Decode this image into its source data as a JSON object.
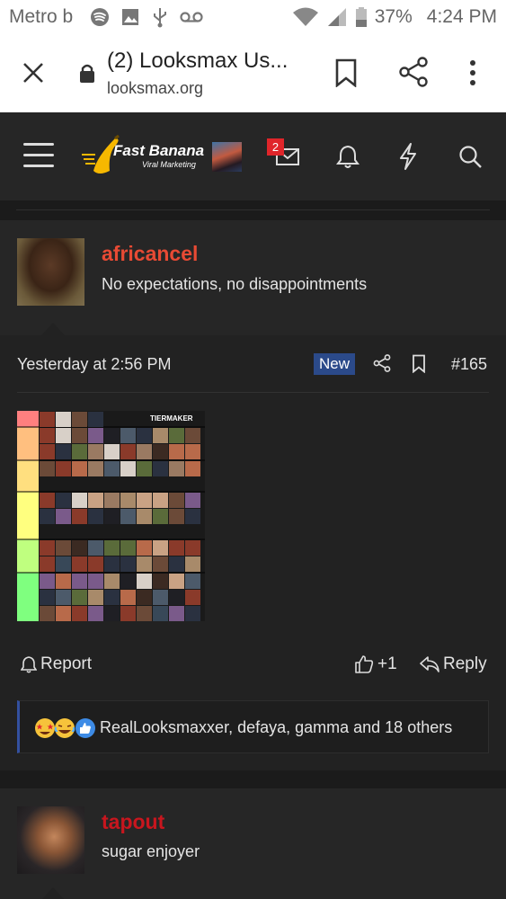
{
  "status_bar": {
    "carrier": "Metro b",
    "battery": "37%",
    "time": "4:24 PM"
  },
  "browser": {
    "tab_title": "(2) Looksmax Us...",
    "url": "looksmax.org"
  },
  "site_header": {
    "logo_title": "Fast Banana",
    "logo_subtitle": "Viral Marketing",
    "inbox_badge": "2"
  },
  "post": {
    "username": "africancel",
    "user_title": "No expectations, no disappointments",
    "date": "Yesterday at 2:56 PM",
    "new_badge": "New",
    "post_number": "#165",
    "attachment_label": "TIERMAKER",
    "actions": {
      "report": "Report",
      "like_count": "+1",
      "reply": "Reply"
    },
    "reactions_text": "RealLooksmaxxer, defaya, gamma and 18 others"
  },
  "next_post": {
    "username": "tapout",
    "user_title": "sugar enjoyer"
  },
  "colors": {
    "username_primary": "#e84a34",
    "username_secondary": "#c8161e",
    "new_badge": "#2b4a8a",
    "badge_red": "#e0252a"
  }
}
